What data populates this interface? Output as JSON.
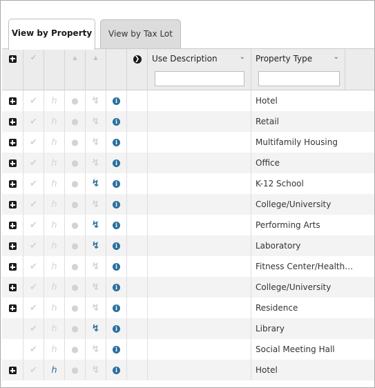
{
  "tabs": [
    {
      "label": "View by Property",
      "active": true
    },
    {
      "label": "View by Tax Lot",
      "active": false
    }
  ],
  "columns": {
    "use_description": {
      "label": "Use Description",
      "filter_value": ""
    },
    "property_type": {
      "label": "Property Type",
      "filter_value": ""
    }
  },
  "icons": {
    "expand": "plus-square-icon",
    "check": "checkmark-icon",
    "wheelchair": "accessibility-icon",
    "comment": "comment-icon",
    "bolt": "lightning-bolt-icon",
    "info": "info-circle-icon",
    "collapse_all": "circle-arrow-right-icon"
  },
  "colors": {
    "accent": "#2b6f9e",
    "muted": "#d3d3d3"
  },
  "rows": [
    {
      "property_type": "Hotel",
      "expand": true,
      "access_active": false,
      "bolt_active": false
    },
    {
      "property_type": "Retail",
      "expand": true,
      "access_active": false,
      "bolt_active": false
    },
    {
      "property_type": "Multifamily Housing",
      "expand": true,
      "access_active": false,
      "bolt_active": false
    },
    {
      "property_type": "Office",
      "expand": true,
      "access_active": false,
      "bolt_active": false
    },
    {
      "property_type": "K-12 School",
      "expand": true,
      "access_active": false,
      "bolt_active": true
    },
    {
      "property_type": "College/University",
      "expand": true,
      "access_active": false,
      "bolt_active": false
    },
    {
      "property_type": "Performing Arts",
      "expand": true,
      "access_active": false,
      "bolt_active": true
    },
    {
      "property_type": "Laboratory",
      "expand": true,
      "access_active": false,
      "bolt_active": true
    },
    {
      "property_type": "Fitness Center/Health ...",
      "expand": true,
      "access_active": false,
      "bolt_active": false
    },
    {
      "property_type": "College/University",
      "expand": true,
      "access_active": false,
      "bolt_active": false
    },
    {
      "property_type": "Residence",
      "expand": true,
      "access_active": false,
      "bolt_active": false
    },
    {
      "property_type": "Library",
      "expand": false,
      "access_active": false,
      "bolt_active": true
    },
    {
      "property_type": "Social Meeting Hall",
      "expand": false,
      "access_active": false,
      "bolt_active": false
    },
    {
      "property_type": "Hotel",
      "expand": true,
      "access_active": true,
      "bolt_active": false
    }
  ]
}
